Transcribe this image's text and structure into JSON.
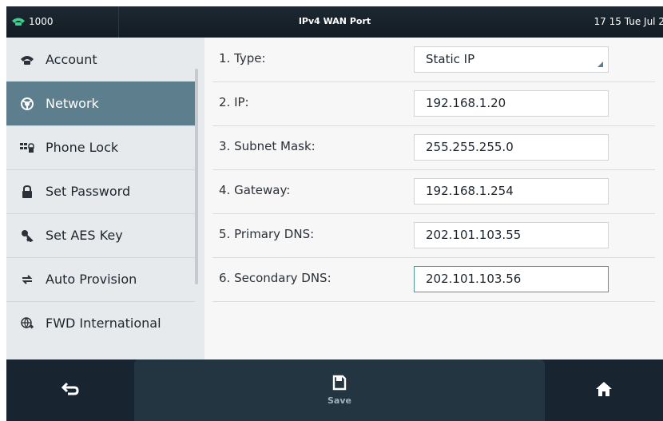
{
  "statusbar": {
    "account": "1000",
    "title": "IPv4 WAN Port",
    "datetime": "17 15 Tue Jul 2:"
  },
  "sidebar": {
    "items": [
      {
        "label": "Account",
        "icon": "phone-icon"
      },
      {
        "label": "Network",
        "icon": "network-icon",
        "active": true
      },
      {
        "label": "Phone Lock",
        "icon": "keypad-icon"
      },
      {
        "label": "Set Password",
        "icon": "lock-icon"
      },
      {
        "label": "Set AES Key",
        "icon": "key-icon"
      },
      {
        "label": "Auto Provision",
        "icon": "sync-icon"
      },
      {
        "label": "FWD International",
        "icon": "globe-icon"
      }
    ]
  },
  "form": {
    "rows": [
      {
        "label": "1. Type:",
        "value": "Static IP"
      },
      {
        "label": "2. IP:",
        "value": "192.168.1.20"
      },
      {
        "label": "3. Subnet Mask:",
        "value": "255.255.255.0"
      },
      {
        "label": "4. Gateway:",
        "value": "192.168.1.254"
      },
      {
        "label": "5. Primary DNS:",
        "value": "202.101.103.55"
      },
      {
        "label": "6. Secondary DNS:",
        "value": "202.101.103.56"
      }
    ]
  },
  "softkeys": {
    "back_icon": "back-arrow-icon",
    "save_label": "Save",
    "home_icon": "home-icon"
  },
  "colors": {
    "accent": "#5d7e8d",
    "status_icon": "#3fcf8e",
    "bottombar": "#182430"
  }
}
